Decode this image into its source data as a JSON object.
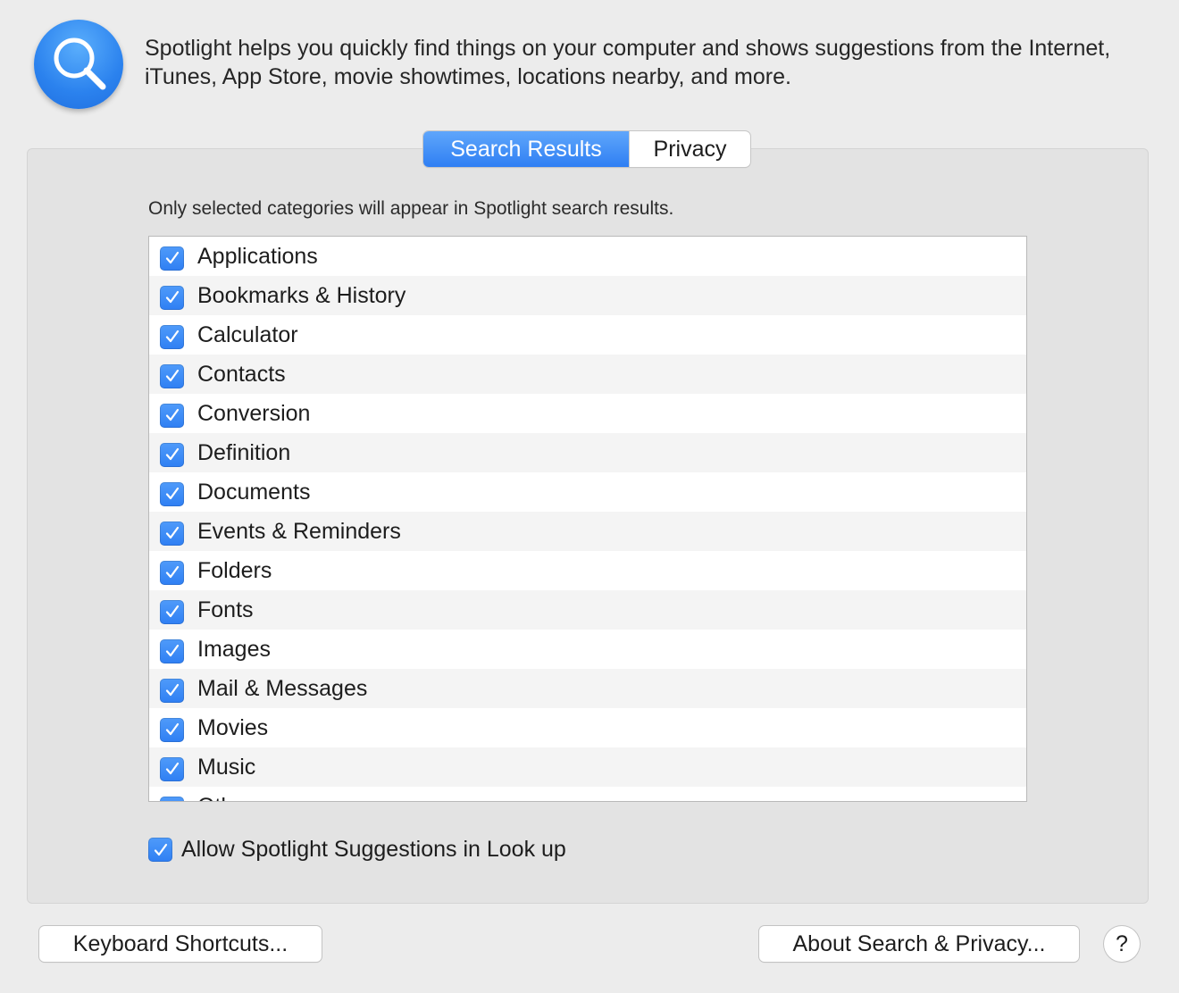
{
  "header": {
    "icon": "spotlight-magnifier-icon",
    "description": "Spotlight helps you quickly find things on your computer and shows suggestions from the Internet, iTunes, App Store, movie showtimes, locations nearby, and more."
  },
  "tabs": [
    {
      "label": "Search Results",
      "selected": true
    },
    {
      "label": "Privacy",
      "selected": false
    }
  ],
  "caption": "Only selected categories will appear in Spotlight search results.",
  "categories": [
    {
      "label": "Applications",
      "checked": true
    },
    {
      "label": "Bookmarks & History",
      "checked": true
    },
    {
      "label": "Calculator",
      "checked": true
    },
    {
      "label": "Contacts",
      "checked": true
    },
    {
      "label": "Conversion",
      "checked": true
    },
    {
      "label": "Definition",
      "checked": true
    },
    {
      "label": "Documents",
      "checked": true
    },
    {
      "label": "Events & Reminders",
      "checked": true
    },
    {
      "label": "Folders",
      "checked": true
    },
    {
      "label": "Fonts",
      "checked": true
    },
    {
      "label": "Images",
      "checked": true
    },
    {
      "label": "Mail & Messages",
      "checked": true
    },
    {
      "label": "Movies",
      "checked": true
    },
    {
      "label": "Music",
      "checked": true
    },
    {
      "label": "Other",
      "checked": true
    }
  ],
  "allow_suggestions": {
    "label": "Allow Spotlight Suggestions in Look up",
    "checked": true
  },
  "buttons": {
    "keyboard_shortcuts": "Keyboard Shortcuts...",
    "about": "About Search & Privacy...",
    "help": "?"
  },
  "colors": {
    "accent": "#2f7ff3",
    "window_bg": "#ececec",
    "group_bg": "#e3e3e3"
  }
}
